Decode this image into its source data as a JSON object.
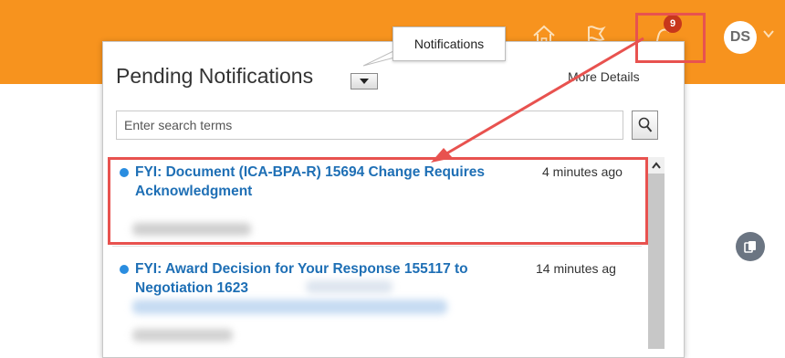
{
  "header": {
    "nav_icons": [
      "home-icon",
      "flag-icon",
      "bell-icon"
    ],
    "notification_count": "9",
    "avatar_initials": "DS",
    "colors": {
      "bar": "#f7931e",
      "badge": "#c7371b"
    }
  },
  "tooltip": {
    "text": "Notifications"
  },
  "popup": {
    "title": "Pending Notifications",
    "more_details": "More Details",
    "search": {
      "placeholder": "Enter search terms",
      "value": ""
    },
    "notifications": [
      {
        "title": "FYI: Document (ICA-BPA-R) 15694 Change Requires Acknowledgment",
        "time": "4 minutes ago",
        "unread": true
      },
      {
        "title": "FYI: Award Decision for Your Response 155117 to Negotiation 1623",
        "time": "14 minutes ag",
        "unread": true
      }
    ]
  },
  "annotation": {
    "highlight_color": "#e8524f"
  }
}
